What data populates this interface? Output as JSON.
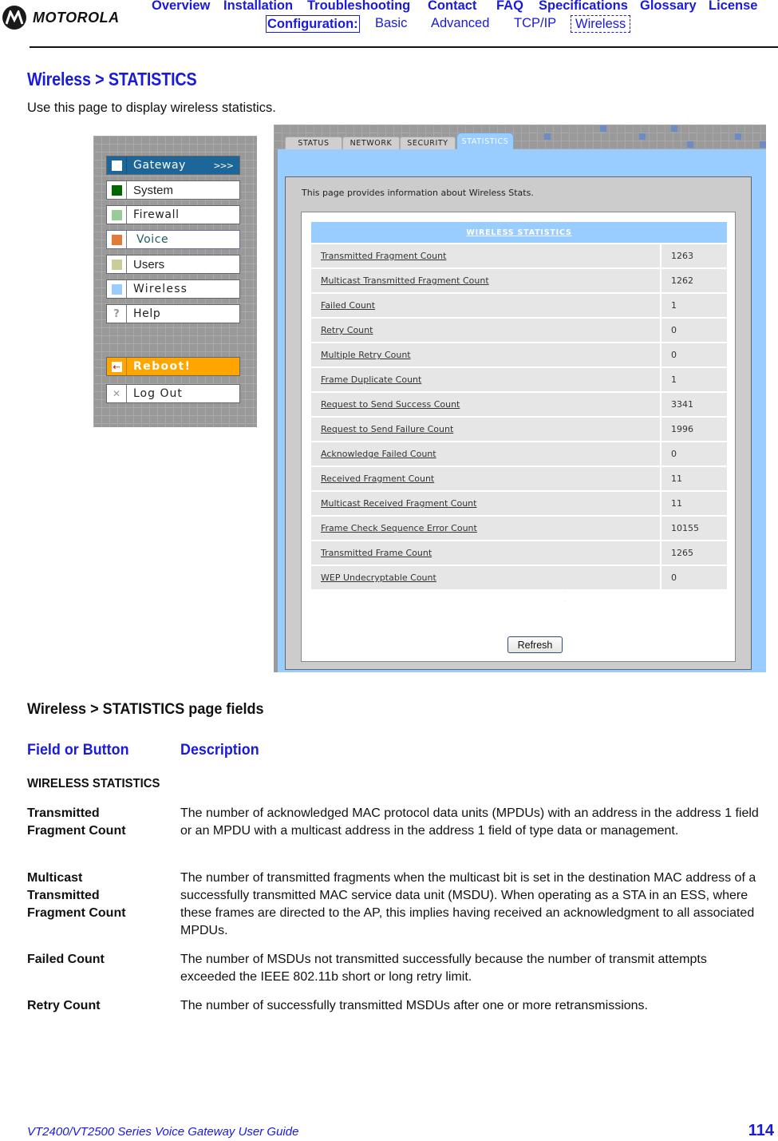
{
  "header": {
    "brand": "MOTOROLA",
    "nav": [
      "Overview",
      "Installation",
      "Troubleshooting",
      "Contact",
      "FAQ",
      "Specifications",
      "Glossary",
      "License"
    ],
    "subnav_label": "Configuration:",
    "subnav": [
      "Basic",
      "Advanced",
      "TCP/IP",
      "Wireless"
    ],
    "subnav_selected": "Wireless"
  },
  "page": {
    "title": "Wireless > STATISTICS",
    "intro": "Use this page to display wireless statistics."
  },
  "menu": {
    "items": [
      {
        "label": "Gateway",
        "color": "#ffffff",
        "active": true,
        "suffix": ">>>"
      },
      {
        "label": "System",
        "color": "#006600"
      },
      {
        "label": "Firewall",
        "color": "#99cc99"
      },
      {
        "label": "Voice",
        "color": "#e07b39"
      },
      {
        "label": "Users",
        "color": "#cccc99"
      },
      {
        "label": "Wireless",
        "color": "#99ccff"
      },
      {
        "label": "Help",
        "icon": "?"
      }
    ],
    "reboot": {
      "label": "Reboot!",
      "icon": "⇠"
    },
    "logout": {
      "label": "Log Out",
      "icon": "✕"
    }
  },
  "app": {
    "tabs": [
      "STATUS",
      "NETWORK",
      "SECURITY",
      "STATISTICS"
    ],
    "active_tab": "STATISTICS",
    "description": "This page provides information about Wireless Stats.",
    "table_title": "WIRELESS STATISTICS",
    "rows": [
      {
        "name": "Transmitted Fragment Count",
        "value": "1263"
      },
      {
        "name": "Multicast Transmitted Fragment Count",
        "value": "1262"
      },
      {
        "name": "Failed Count",
        "value": "1"
      },
      {
        "name": "Retry Count",
        "value": "0"
      },
      {
        "name": "Multiple Retry Count",
        "value": "0"
      },
      {
        "name": "Frame Duplicate Count",
        "value": "1"
      },
      {
        "name": "Request to Send Success Count",
        "value": "3341"
      },
      {
        "name": "Request to Send Failure Count",
        "value": "1996"
      },
      {
        "name": "Acknowledge Failed Count",
        "value": "0"
      },
      {
        "name": "Received Fragment Count",
        "value": "11"
      },
      {
        "name": "Multicast Received Fragment Count",
        "value": "11"
      },
      {
        "name": "Frame Check Sequence Error Count",
        "value": "10155"
      },
      {
        "name": "Transmitted Frame Count",
        "value": "1265"
      },
      {
        "name": "WEP Undecryptable Count",
        "value": "0"
      }
    ],
    "refresh_label": "Refresh"
  },
  "fields": {
    "section_title": "Wireless > STATISTICS page fields",
    "col_field": "Field or Button",
    "col_desc": "Description",
    "group": "WIRELESS STATISTICS",
    "rows": [
      {
        "name": "Transmitted Fragment Count",
        "desc": "The number of acknowledged MAC protocol data units (MPDUs) with an address in the address 1 field or an MPDU with a multicast address in the address 1 field of type data or management."
      },
      {
        "name": "Multicast Transmitted Fragment Count",
        "desc": "The number of transmitted fragments when the multicast bit is set in the destination MAC address of a successfully transmitted MAC service data unit (MSDU). When operating as a STA in an ESS, where these frames are directed to the AP, this implies having received an acknowledgment to all associated MPDUs."
      },
      {
        "name": "Failed Count",
        "desc": "The number of MSDUs not transmitted successfully because the number of transmit attempts exceeded the IEEE 802.11b short or long retry limit."
      },
      {
        "name": "Retry Count",
        "desc": "The number of successfully transmitted MSDUs after one or more retransmissions."
      }
    ]
  },
  "footer": {
    "guide_title": "VT2400/VT2500 Series Voice Gateway User Guide",
    "page_number": "114"
  }
}
